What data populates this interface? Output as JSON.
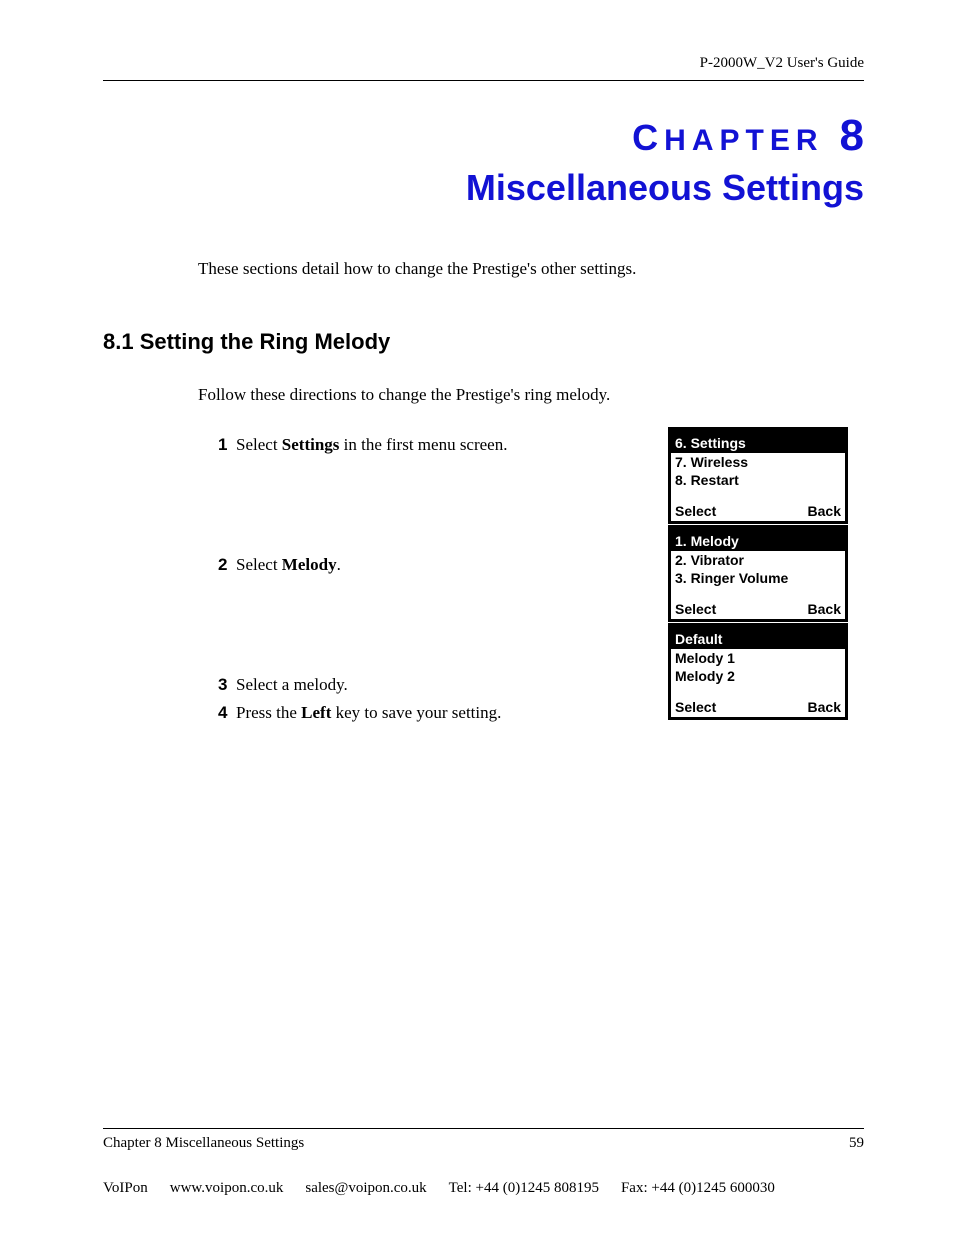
{
  "header": {
    "guide": "P-2000W_V2 User's Guide"
  },
  "chapter": {
    "label_prefix": "C",
    "label_rest": "HAPTER",
    "number": "8",
    "title": "Miscellaneous Settings",
    "intro": "These sections detail how to change the Prestige's other settings."
  },
  "section": {
    "heading": "8.1  Setting the Ring Melody",
    "intro": "Follow these directions to change the Prestige's ring melody."
  },
  "steps": {
    "s1": {
      "n": "1",
      "pre": "Select ",
      "bold": "Settings",
      "post": " in the first menu screen."
    },
    "s2": {
      "n": "2",
      "pre": "Select ",
      "bold": "Melody",
      "post": "."
    },
    "s3": {
      "n": "3",
      "pre": "Select a melody.",
      "bold": "",
      "post": ""
    },
    "s4": {
      "n": "4",
      "pre": "Press the ",
      "bold": "Left",
      "post": " key to save your setting."
    }
  },
  "screens": {
    "a": {
      "sel": "6. Settings",
      "r1": "7. Wireless",
      "r2": "8. Restart",
      "sk_l": "Select",
      "sk_r": "Back"
    },
    "b": {
      "sel": "1. Melody",
      "r1": "2. Vibrator",
      "r2": "3. Ringer Volume",
      "sk_l": "Select",
      "sk_r": "Back"
    },
    "c": {
      "sel": "Default",
      "r1": "Melody 1",
      "r2": "Melody 2",
      "sk_l": "Select",
      "sk_r": "Back"
    }
  },
  "footer": {
    "chapter_ref": "Chapter 8 Miscellaneous Settings",
    "page": "59",
    "vendor": {
      "name": "VoIPon",
      "site": "www.voipon.co.uk",
      "email": "sales@voipon.co.uk",
      "tel": "Tel: +44 (0)1245 808195",
      "fax": "Fax: +44 (0)1245 600030"
    }
  }
}
